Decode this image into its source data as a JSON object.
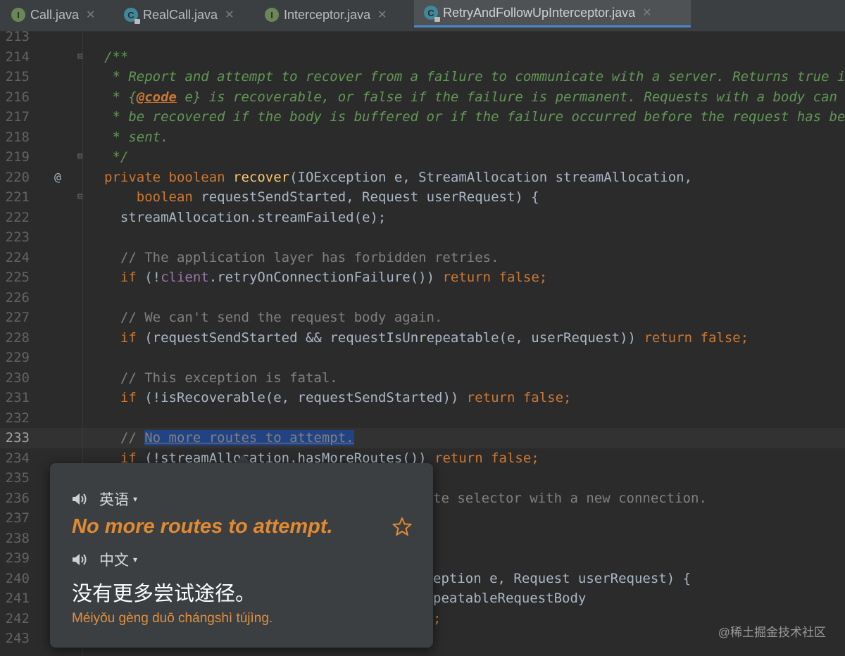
{
  "tabs": [
    {
      "name": "Call.java",
      "icon": "interface-file-icon",
      "letter": "I",
      "active": false
    },
    {
      "name": "RealCall.java",
      "icon": "class-file-icon",
      "letter": "C",
      "active": false
    },
    {
      "name": "Interceptor.java",
      "icon": "interface-file-icon",
      "letter": "I",
      "active": false
    },
    {
      "name": "RetryAndFollowUpInterceptor.java",
      "icon": "class-file-icon",
      "letter": "C",
      "active": true
    }
  ],
  "tab_close_glyph": "✕",
  "gutter": {
    "override_marker": "@"
  },
  "line_numbers": [
    "213",
    "214",
    "215",
    "216",
    "217",
    "218",
    "219",
    "220",
    "221",
    "222",
    "223",
    "224",
    "225",
    "226",
    "227",
    "228",
    "229",
    "230",
    "231",
    "232",
    "233",
    "234",
    "235",
    "236",
    "237",
    "238",
    "239",
    "240",
    "241",
    "242",
    "243"
  ],
  "current_line": "233",
  "code": {
    "l214": "/**",
    "l215": " * Report and attempt to recover from a failure to communicate with a server. Returns true if",
    "l216_tag": "@code",
    "l216_rest": " e} is recoverable, or false if the failure is permanent. Requests with a body can only",
    "l217": " * be recovered if the body is buffered or if the failure occurred before the request has been",
    "l218": " * sent.",
    "l219": " */",
    "l222": "  streamAllocation.streamFailed(e);",
    "l224": "  // The application layer has forbidden retries.",
    "l227": "  // We can't send the request body again.",
    "l230": "  // This exception is fatal.",
    "l233_selected": "No more routes to attempt.",
    "l236_visible": "te selector with a new connection.",
    "l240_visible": "eption e, Request userRequest) {",
    "l241_visible": "peatableRequestBody",
    "l242_visible": ";"
  },
  "translation_popup": {
    "source_lang": "英语",
    "source_text": "No more routes to attempt.",
    "target_lang": "中文",
    "target_text": "没有更多尝试途径。",
    "pinyin": "Méiyǒu gèng duō chángshì tújìng.",
    "dropdown_glyph": "▾"
  },
  "watermark": "@稀土掘金技术社区",
  "colors": {
    "background": "#2b2b2b",
    "keyword": "#cc7832",
    "method": "#ffc66d",
    "doc_comment": "#629755",
    "comment": "#808080",
    "field": "#9876aa",
    "selection": "#214283",
    "popup_accent": "#e28a32"
  }
}
